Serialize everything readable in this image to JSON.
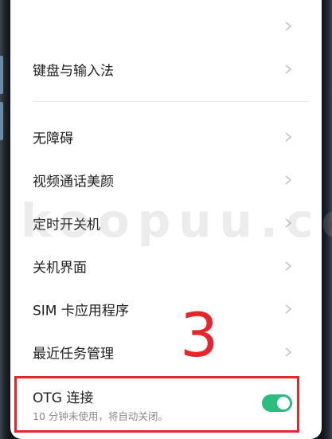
{
  "settings": {
    "items": [
      {
        "label": ""
      },
      {
        "label": "键盘与输入法"
      },
      {
        "label": "无障碍"
      },
      {
        "label": "视频通话美颜"
      },
      {
        "label": "定时开关机"
      },
      {
        "label": "关机界面"
      },
      {
        "label": "SIM 卡应用程序"
      },
      {
        "label": "最近任务管理"
      }
    ],
    "otg": {
      "title": "OTG 连接",
      "subtitle": "10 分钟未使用，将自动关闭。",
      "enabled": true
    }
  },
  "annotation": {
    "step": "3"
  },
  "watermark": {
    "text": "koopuu.co"
  },
  "colors": {
    "toggle_on": "#2bbd7e",
    "highlight": "#e5262b"
  },
  "icons": {
    "row_chevron": "chevron-right-icon"
  }
}
